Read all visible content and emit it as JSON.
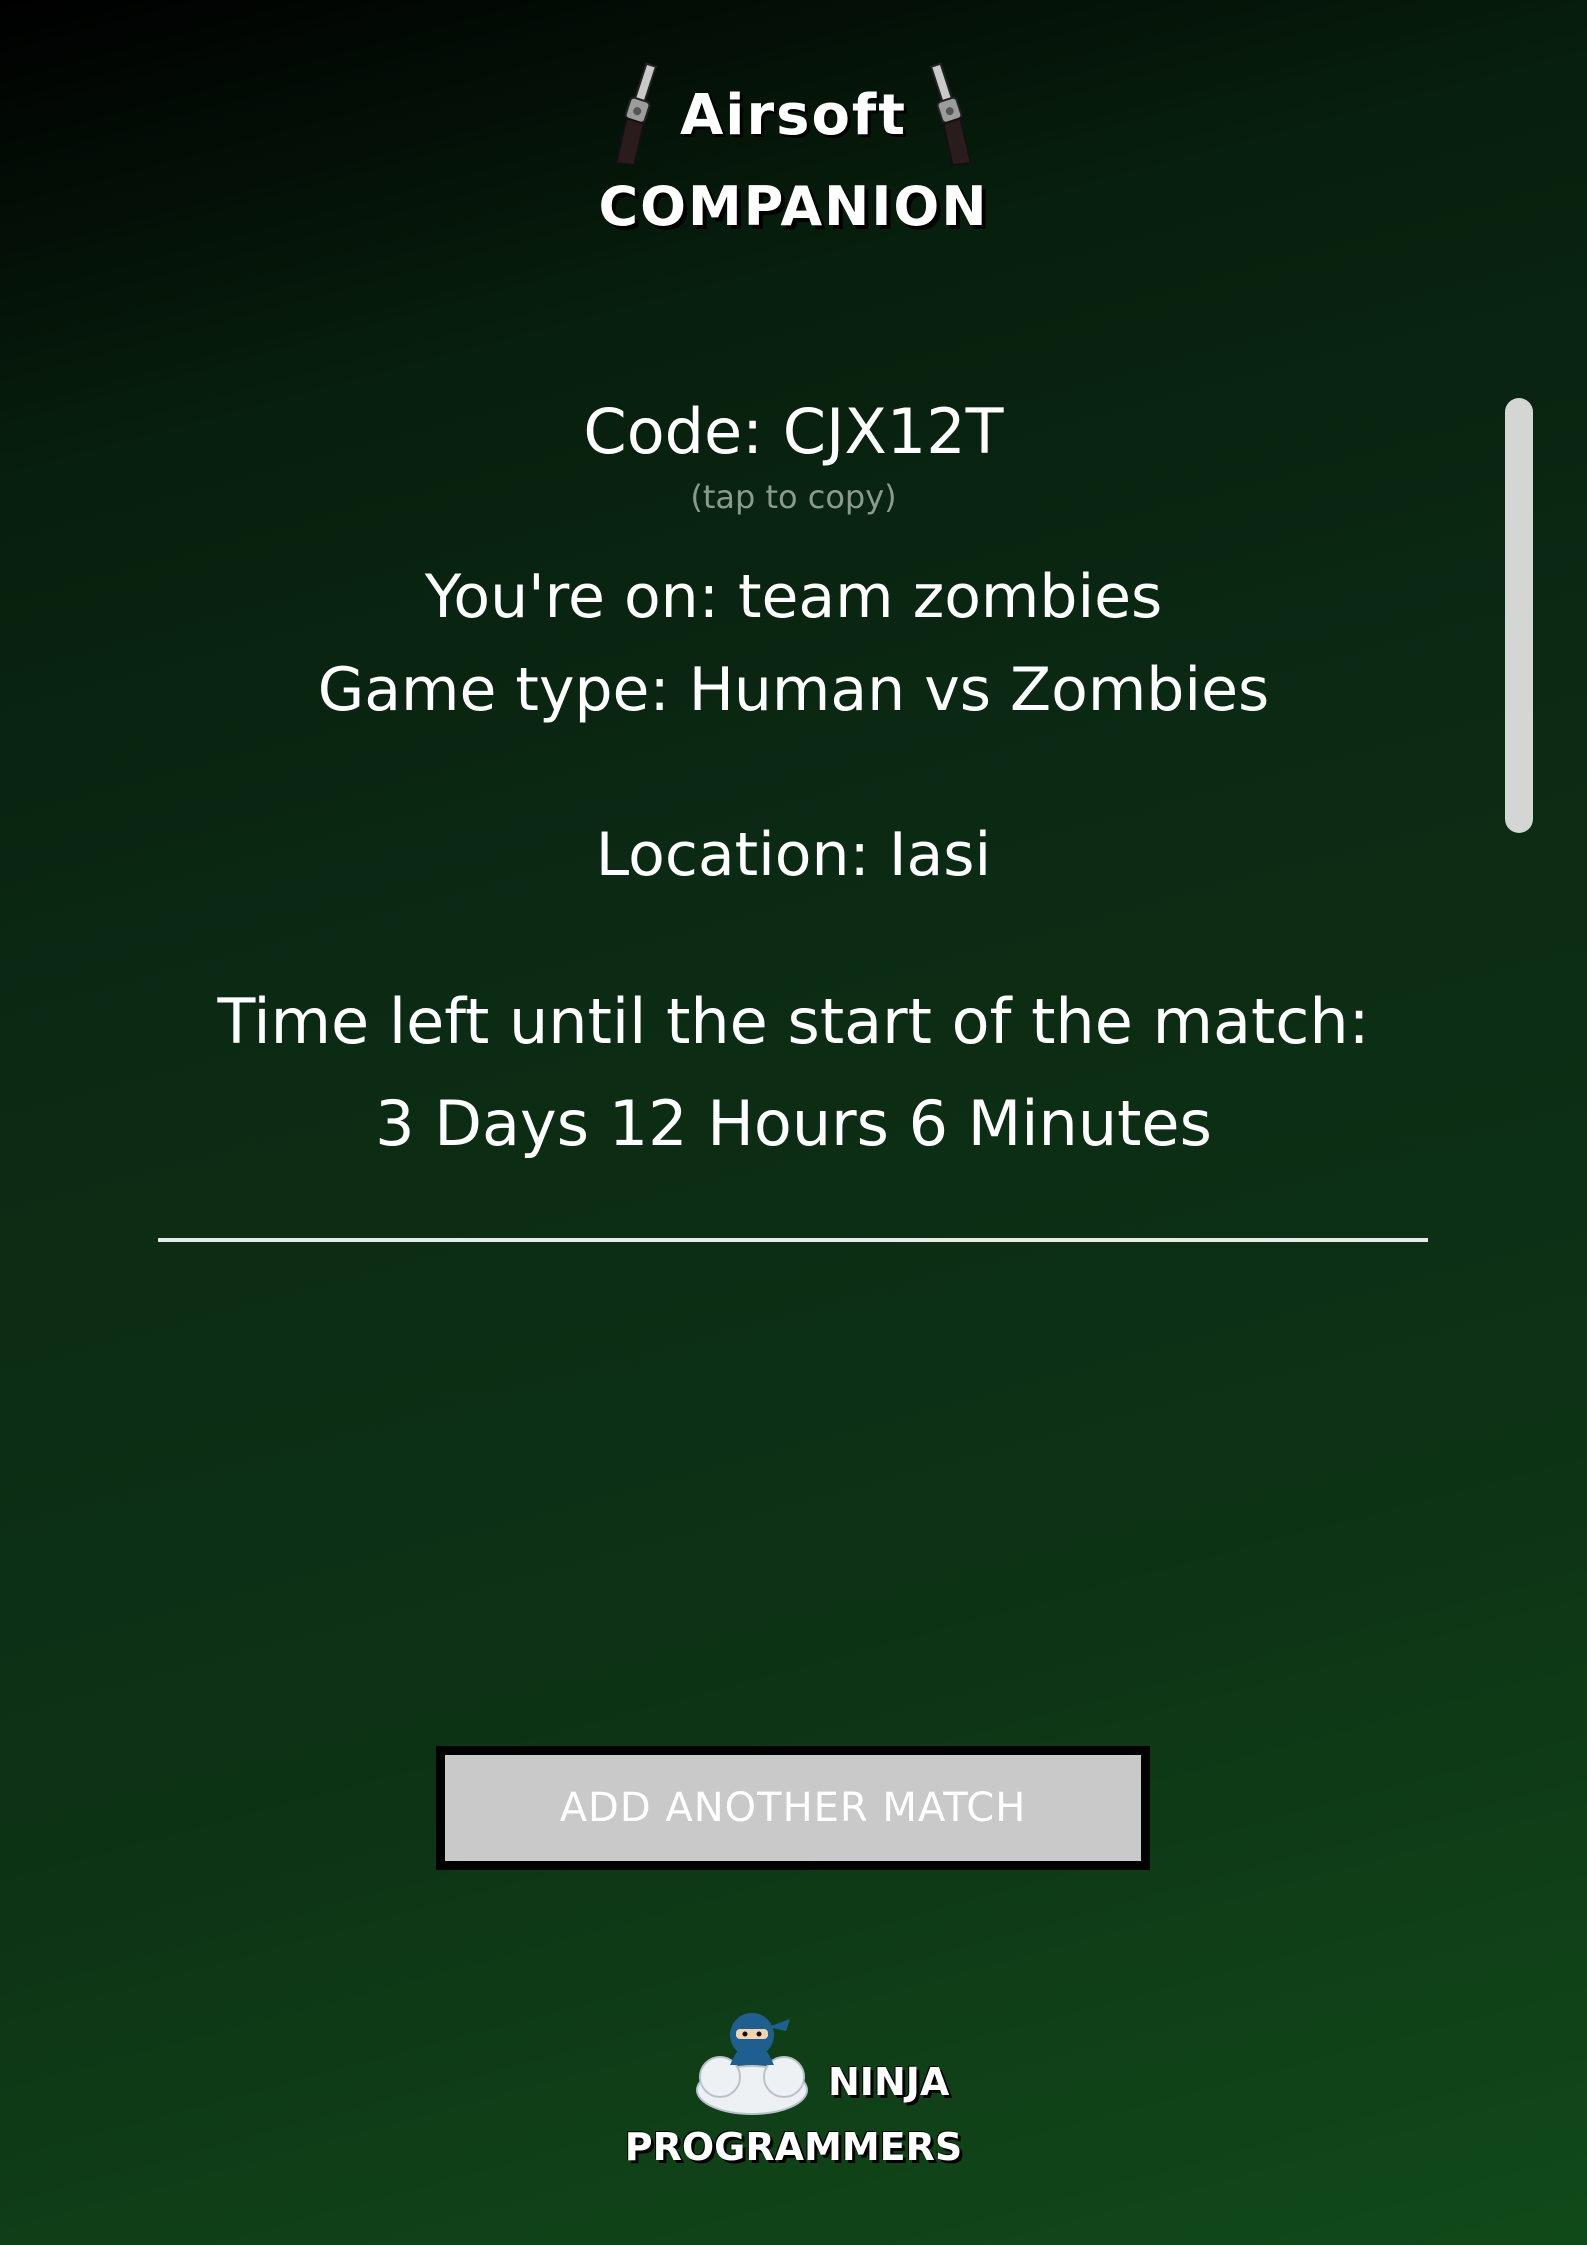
{
  "header": {
    "title": "Airsoft",
    "subtitle": "COMPANION"
  },
  "match": {
    "code_text": "Code: CJX12T",
    "copy_hint": "(tap to copy)",
    "team_text": "You're on: team zombies",
    "gametype_text": "Game type: Human vs Zombies",
    "location_text": "Location: Iasi",
    "timeleft_label": "Time left until the start of the match:",
    "timeleft_value": "3 Days 12 Hours 6 Minutes"
  },
  "actions": {
    "add_match_label": "ADD ANOTHER MATCH"
  },
  "footer": {
    "brand_line1": "NINJA",
    "brand_line2": "PROGRAMMERS"
  },
  "icons": {
    "left_revolver": "revolver-icon",
    "right_revolver": "revolver-icon",
    "footer_logo": "ninja-cloud-logo"
  },
  "colors": {
    "background_dark": "#000000",
    "background_green": "#114a19",
    "text": "#ffffff",
    "hint": "#8b9a8e",
    "button_bg": "#c8c9c8",
    "button_border": "#000000",
    "scrollbar": "#d4d6d4"
  }
}
